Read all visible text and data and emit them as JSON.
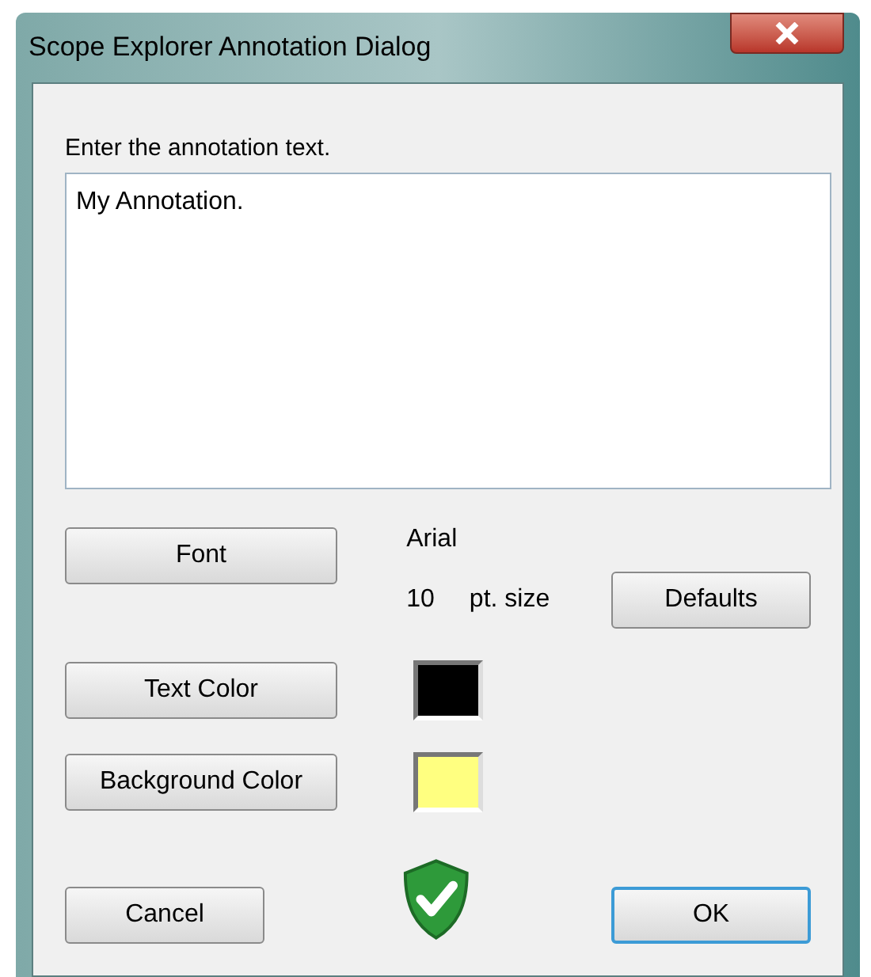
{
  "window": {
    "title": "Scope Explorer Annotation Dialog"
  },
  "prompt": "Enter the annotation text.",
  "annotation": {
    "value": "My Annotation."
  },
  "font_button": "Font",
  "font_name": "Arial",
  "font_size": "10",
  "size_unit": "pt. size",
  "defaults_button": "Defaults",
  "color_rows": [
    {
      "label": "Text Color",
      "color": "#000000"
    },
    {
      "label": "Background Color",
      "color": "#ffff80"
    }
  ],
  "footer_buttons": [
    {
      "label": "Cancel",
      "default": false
    },
    {
      "label": "OK",
      "default": true
    }
  ]
}
